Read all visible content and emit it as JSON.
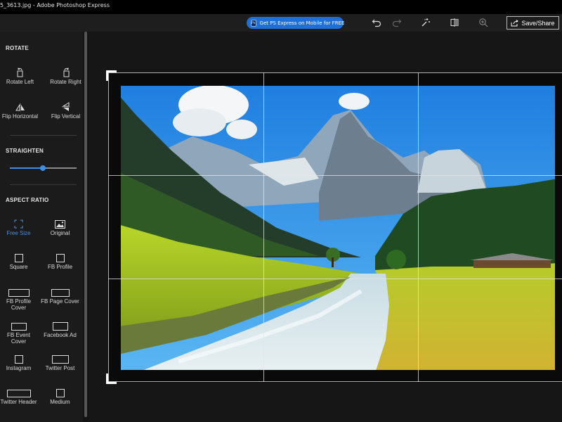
{
  "window": {
    "title": "5_3613.jpg - Adobe Photoshop Express"
  },
  "toolbar": {
    "promo_label": "Get PS Express on Mobile for FREE",
    "promo_icon": "Ps",
    "save_label": "Save/Share"
  },
  "sidebar": {
    "rotate": {
      "heading": "ROTATE",
      "items": [
        "Rotate Left",
        "Rotate Right",
        "Flip Horizontal",
        "Flip Vertical"
      ]
    },
    "straighten": {
      "heading": "STRAIGHTEN",
      "value": 0.5
    },
    "aspect": {
      "heading": "ASPECT RATIO",
      "items": [
        {
          "label": "Free Size",
          "selected": true
        },
        {
          "label": "Original"
        },
        {
          "label": "Square"
        },
        {
          "label": "FB Profile"
        },
        {
          "label": "FB Profile Cover"
        },
        {
          "label": "FB Page Cover"
        },
        {
          "label": "FB Event Cover"
        },
        {
          "label": "Facebook Ad"
        },
        {
          "label": "Instagram"
        },
        {
          "label": "Twitter Post"
        },
        {
          "label": "Twitter Header"
        },
        {
          "label": "Medium"
        }
      ]
    }
  },
  "colors": {
    "accent": "#3c8ee8",
    "promo": "#1f6fd8",
    "background": "#151515",
    "sidebar": "#1b1b1b"
  }
}
